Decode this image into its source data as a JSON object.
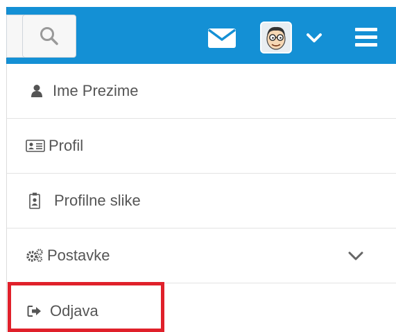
{
  "header": {
    "search_icon": "search-icon",
    "mail_icon": "envelope-icon",
    "avatar_icon": "avatar-icon",
    "chevron_icon": "chevron-down-icon",
    "menu_icon": "hamburger-icon",
    "bar_color": "#1490d5"
  },
  "menu": {
    "items": [
      {
        "label": "Ime Prezime",
        "icon": "user-icon"
      },
      {
        "label": "Profil",
        "icon": "id-card-icon"
      },
      {
        "label": "Profilne slike",
        "icon": "photo-badge-icon"
      },
      {
        "label": "Postavke",
        "icon": "gears-icon",
        "expand_icon": "chevron-down-icon"
      },
      {
        "label": "Odjava",
        "icon": "sign-out-icon"
      }
    ]
  },
  "highlight_color": "#e0202a"
}
